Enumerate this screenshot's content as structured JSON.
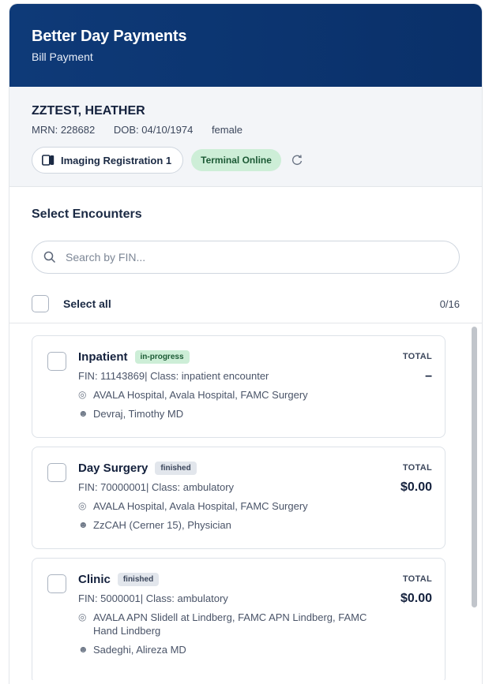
{
  "header": {
    "title": "Better Day Payments",
    "subtitle": "Bill Payment"
  },
  "patient": {
    "name": "ZZTEST, HEATHER",
    "mrn": "MRN: 228682",
    "dob": "DOB: 04/10/1974",
    "sex": "female",
    "location": "Imaging Registration 1",
    "terminal_status": "Terminal Online"
  },
  "encounters": {
    "title": "Select Encounters",
    "search_placeholder": "Search by FIN...",
    "select_all_label": "Select all",
    "selected_count": "0/16",
    "total_label": "TOTAL",
    "items": [
      {
        "title": "Inpatient",
        "status": "in-progress",
        "fin": "FIN: 11143869| Class: inpatient encounter",
        "location": "AVALA Hospital, Avala Hospital, FAMC Surgery",
        "provider": "Devraj, Timothy MD",
        "total": "–"
      },
      {
        "title": "Day Surgery",
        "status": "finished",
        "fin": "FIN: 70000001| Class: ambulatory",
        "location": "AVALA Hospital, Avala Hospital, FAMC Surgery",
        "provider": "ZzCAH (Cerner 15), Physician",
        "total": "$0.00"
      },
      {
        "title": "Clinic",
        "status": "finished",
        "fin": "FIN: 5000001| Class: ambulatory",
        "location": "AVALA APN Slidell at Lindberg, FAMC APN Lindberg, FAMC Hand Lindberg",
        "provider": "Sadeghi, Alireza MD",
        "total": "$0.00"
      }
    ]
  },
  "colors": {
    "header_bg": "#0e3a78",
    "status_green_bg": "#cdeed7",
    "status_green_text": "#1c5a35"
  }
}
